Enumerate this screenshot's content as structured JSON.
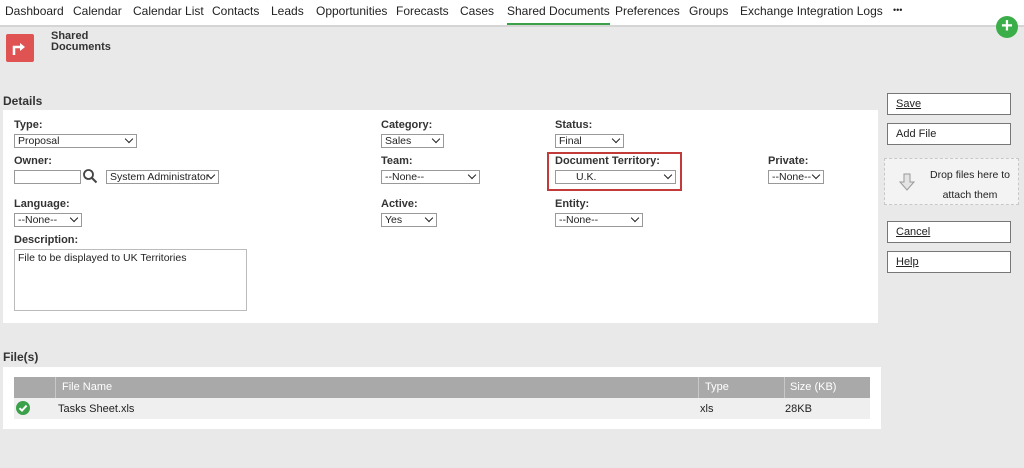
{
  "nav": {
    "items": [
      "Dashboard",
      "Calendar",
      "Calendar List",
      "Contacts",
      "Leads",
      "Opportunities",
      "Forecasts",
      "Cases",
      "Shared Documents",
      "Preferences",
      "Groups",
      "Exchange Integration Logs"
    ],
    "more": "•••",
    "add": "+"
  },
  "header": {
    "title_line1": "Shared",
    "title_line2": "Documents"
  },
  "details": {
    "title": "Details",
    "type": {
      "label": "Type:",
      "value": "Proposal"
    },
    "owner": {
      "label": "Owner:",
      "value": "",
      "user": "System Administrator"
    },
    "language": {
      "label": "Language:",
      "value": "--None--"
    },
    "description": {
      "label": "Description:",
      "value": "File to be displayed to UK Territories"
    },
    "category": {
      "label": "Category:",
      "value": "Sales"
    },
    "team": {
      "label": "Team:",
      "value": "--None--"
    },
    "active": {
      "label": "Active:",
      "value": "Yes"
    },
    "status": {
      "label": "Status:",
      "value": "Final"
    },
    "territory": {
      "label": "Document Territory:",
      "value": "U.K."
    },
    "entity": {
      "label": "Entity:",
      "value": "--None--"
    },
    "private": {
      "label": "Private:",
      "value": "--None--"
    }
  },
  "actions": {
    "save": "Save",
    "add_file": "Add File",
    "drop_line1": "Drop files here to",
    "drop_line2": "attach them",
    "cancel": "Cancel",
    "help": "Help"
  },
  "files": {
    "title": "File(s)",
    "columns": [
      "File Name",
      "Type",
      "Size (KB)"
    ],
    "rows": [
      {
        "name": "Tasks Sheet.xls",
        "type": "xls",
        "size": "28KB"
      }
    ]
  },
  "colors": {
    "accent": "#3aa14a",
    "highlight": "#c33a3a",
    "doc_icon": "#e05353"
  }
}
